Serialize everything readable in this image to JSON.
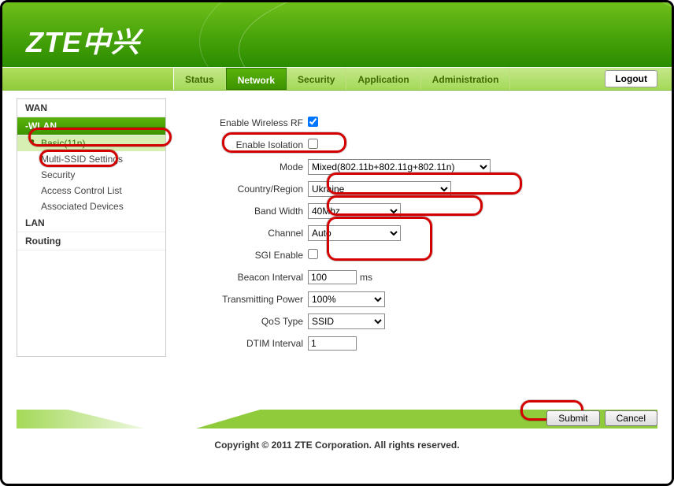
{
  "logo": "ZTE中兴",
  "tabs": {
    "status": "Status",
    "network": "Network",
    "security": "Security",
    "application": "Application",
    "administration": "Administration"
  },
  "logout": "Logout",
  "sidebar": {
    "wan": "WAN",
    "wlan": "-WLAN",
    "basic": "Basic(11n)",
    "multissid": "Multi-SSID Settings",
    "security": "Security",
    "acl": "Access Control List",
    "assoc": "Associated Devices",
    "lan": "LAN",
    "routing": "Routing"
  },
  "form": {
    "enableRF_label": "Enable Wireless RF",
    "enableRF_checked": true,
    "enableIso_label": "Enable Isolation",
    "enableIso_checked": false,
    "mode_label": "Mode",
    "mode_value": "Mixed(802.11b+802.11g+802.11n)",
    "country_label": "Country/Region",
    "country_value": "Ukraine",
    "band_label": "Band Width",
    "band_value": "40Mhz",
    "channel_label": "Channel",
    "channel_value": "Auto",
    "sgi_label": "SGI Enable",
    "sgi_checked": false,
    "beacon_label": "Beacon Interval",
    "beacon_value": "100",
    "beacon_unit": "ms",
    "txpower_label": "Transmitting Power",
    "txpower_value": "100%",
    "qos_label": "QoS Type",
    "qos_value": "SSID",
    "dtim_label": "DTIM Interval",
    "dtim_value": "1"
  },
  "buttons": {
    "submit": "Submit",
    "cancel": "Cancel"
  },
  "copyright": "Copyright © 2011 ZTE Corporation. All rights reserved."
}
